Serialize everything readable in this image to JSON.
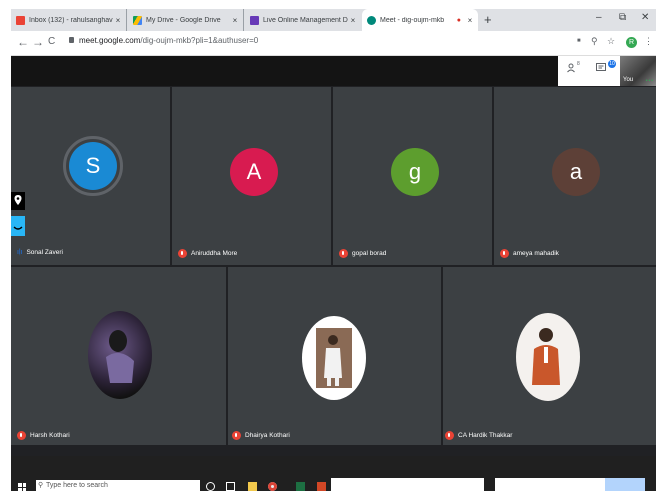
{
  "browser": {
    "tabs": [
      {
        "title": "Inbox (132) - rahulsanghavi@sri",
        "icon": "gmail-icon",
        "icon_color": "#ea4335"
      },
      {
        "title": "My Drive - Google Drive",
        "icon": "drive-icon",
        "icon_color": "#fbbc04"
      },
      {
        "title": "Live Online Management Develo",
        "icon": "forms-icon",
        "icon_color": "#673ab7"
      },
      {
        "title": "Meet - dig-oujm-mkb",
        "icon": "meet-icon",
        "icon_color": "#00897b"
      }
    ],
    "close_glyph": "×",
    "new_tab": "+",
    "window_controls": {
      "minimize": "–",
      "restore": "⧉",
      "close": "✕"
    },
    "nav": {
      "back": "←",
      "forward": "→",
      "reload": "C"
    },
    "url_host": "meet.google.com",
    "url_path": "/dig-oujm-mkb?pli=1&authuser=0",
    "toolbar_icons": {
      "camera": "■",
      "zoom": "⚲",
      "bookmark": "☆",
      "menu": "⋮"
    },
    "profile_initial": "R",
    "recording_dot": "●"
  },
  "meet": {
    "people_count": "8",
    "chat_badge": "10",
    "self_label": "You",
    "self_dots": "•••",
    "participants_row1": [
      {
        "name": "Sonal Zaveri",
        "initial": "S",
        "color": "#1a8ad4",
        "speaking": true
      },
      {
        "name": "Aniruddha More",
        "initial": "A",
        "color": "#d81b50",
        "speaking": false
      },
      {
        "name": "gopal borad",
        "initial": "g",
        "color": "#5d9e2e",
        "speaking": false
      },
      {
        "name": "ameya mahadik",
        "initial": "a",
        "color": "#5d4037",
        "speaking": false
      }
    ],
    "participants_row2": [
      {
        "name": "Harsh Kothari"
      },
      {
        "name": "Dhairya Kothari"
      },
      {
        "name": "CA Hardik Thakkar"
      }
    ]
  },
  "taskbar": {
    "search_placeholder": "Type here to search",
    "search_icon": "⚲",
    "start_icon": "windows-icon"
  }
}
